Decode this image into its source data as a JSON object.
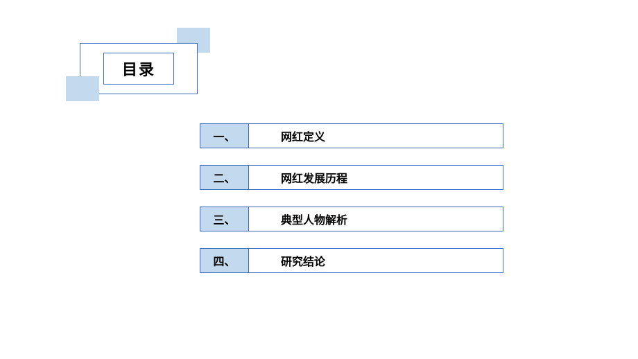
{
  "title": "目录",
  "items": [
    {
      "num": "一、",
      "label": "网红定义"
    },
    {
      "num": "二、",
      "label": "网红发展历程"
    },
    {
      "num": "三、",
      "label": "典型人物解析"
    },
    {
      "num": "四、",
      "label": "研究结论"
    }
  ]
}
